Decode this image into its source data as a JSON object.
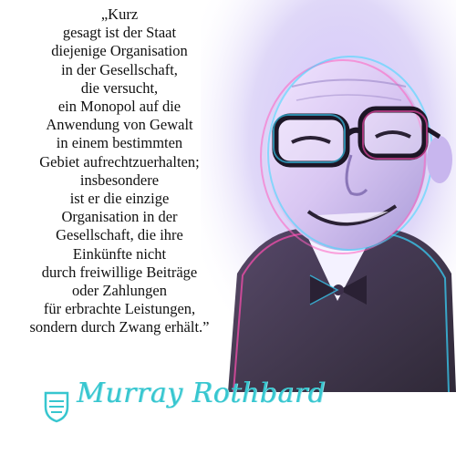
{
  "quote": {
    "lines": [
      "„Kurz",
      "gesagt ist der Staat",
      "diejenige Organisation",
      "in der Gesellschaft,",
      "die versucht,",
      "ein Monopol auf die",
      "Anwendung von Gewalt",
      "in einem bestimmten",
      "Gebiet aufrechtzuerhalten;",
      "insbesondere",
      "ist er die einzige",
      "Organisation in der",
      "Gesellschaft, die ihre",
      "Einkünfte nicht",
      "durch freiwillige Beiträge",
      "oder Zahlungen",
      "für erbrachte Leistungen,",
      "sondern durch Zwang erhält.”"
    ]
  },
  "signature": {
    "text": "Murray Rothbard"
  },
  "colors": {
    "accent": "#37c6cf",
    "text": "#111111",
    "background": "#ffffff"
  },
  "icons": {
    "logo": "shield-logo-icon"
  }
}
